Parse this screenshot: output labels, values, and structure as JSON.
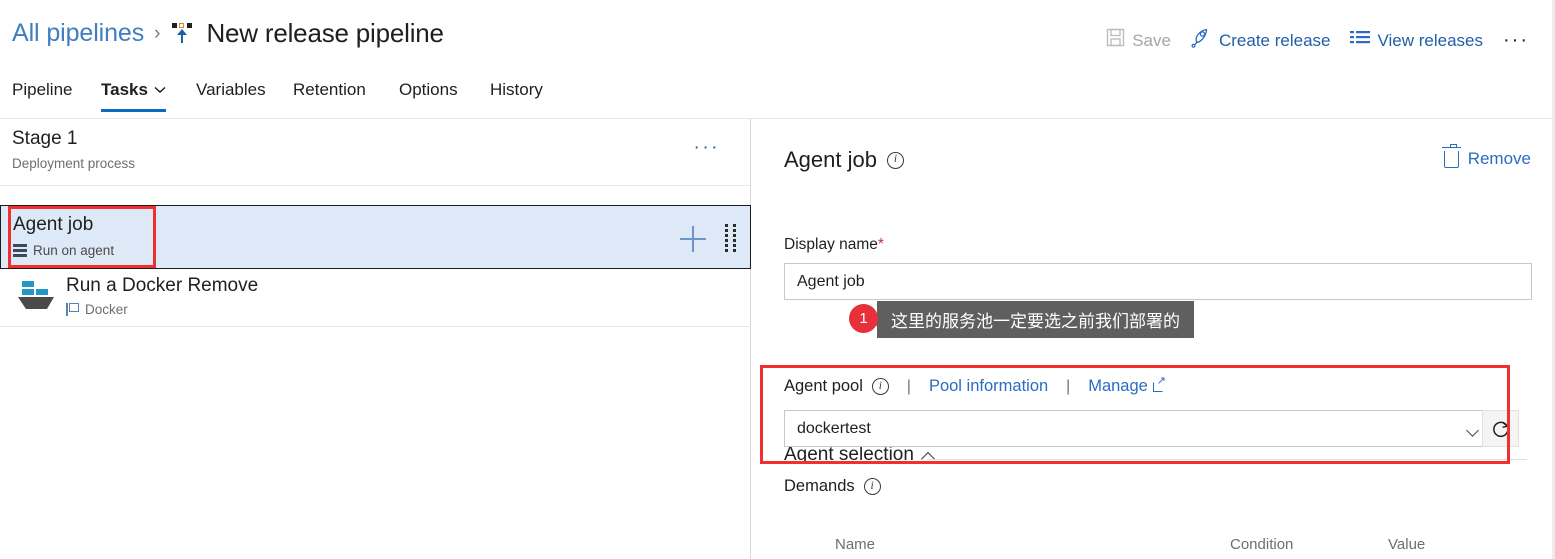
{
  "header": {
    "breadcrumb_root": "All pipelines",
    "breadcrumb_sep": "›",
    "title": "New release pipeline",
    "pipeline_icon": "release-pipeline-icon"
  },
  "toolbar": {
    "save_label": "Save",
    "save_icon": "save-disk-icon",
    "create_release_label": "Create release",
    "create_release_icon": "rocket-icon",
    "view_releases_label": "View releases",
    "view_releases_icon": "list-icon",
    "more_label": "···"
  },
  "tabs": [
    {
      "label": "Pipeline",
      "active": false
    },
    {
      "label": "Tasks",
      "active": true,
      "has_chevron": true
    },
    {
      "label": "Variables",
      "active": false
    },
    {
      "label": "Retention",
      "active": false
    },
    {
      "label": "Options",
      "active": false
    },
    {
      "label": "History",
      "active": false
    }
  ],
  "left_panel": {
    "stage_name": "Stage 1",
    "stage_subtitle": "Deployment process",
    "stage_more_label": "···",
    "job": {
      "title": "Agent job",
      "subtitle": "Run on agent",
      "subtitle_icon": "server-rack-icon",
      "add_icon": "plus-icon",
      "drag_icon": "drag-handle-icon",
      "selected": true
    },
    "task": {
      "title": "Run a Docker Remove",
      "subtitle": "Docker",
      "icon": "docker-whale-icon",
      "subtitle_icon": "flag-icon"
    }
  },
  "right_panel": {
    "title": "Agent job",
    "title_info_icon": "info-icon",
    "remove_label": "Remove",
    "remove_icon": "trash-icon",
    "display_name_label": "Display name",
    "display_name_required": "*",
    "display_name_value": "Agent job",
    "section_title": "Agent selection",
    "section_chevron_icon": "chevron-up-icon",
    "agent_pool_label": "Agent pool",
    "agent_pool_info_icon": "info-icon",
    "pool_information_link": "Pool information",
    "manage_link": "Manage",
    "manage_external_icon": "external-link-icon",
    "link_separator": "|",
    "agent_pool_value": "dockertest",
    "agent_pool_chevron_icon": "chevron-down-icon",
    "refresh_icon": "refresh-icon",
    "demands_label": "Demands",
    "demands_info_icon": "info-icon",
    "demands_columns": [
      "Name",
      "Condition",
      "Value"
    ]
  },
  "annotation": {
    "badge_number": "1",
    "tooltip_text": "这里的服务池一定要选之前我们部署的",
    "highlight_color": "#f03030",
    "badge_color": "#e8303a",
    "tooltip_bg": "#5f5f5f"
  },
  "colors": {
    "accent_blue": "#0b6cbf",
    "link_blue": "#2a6cc4",
    "selected_row_bg": "#dee9f7"
  }
}
